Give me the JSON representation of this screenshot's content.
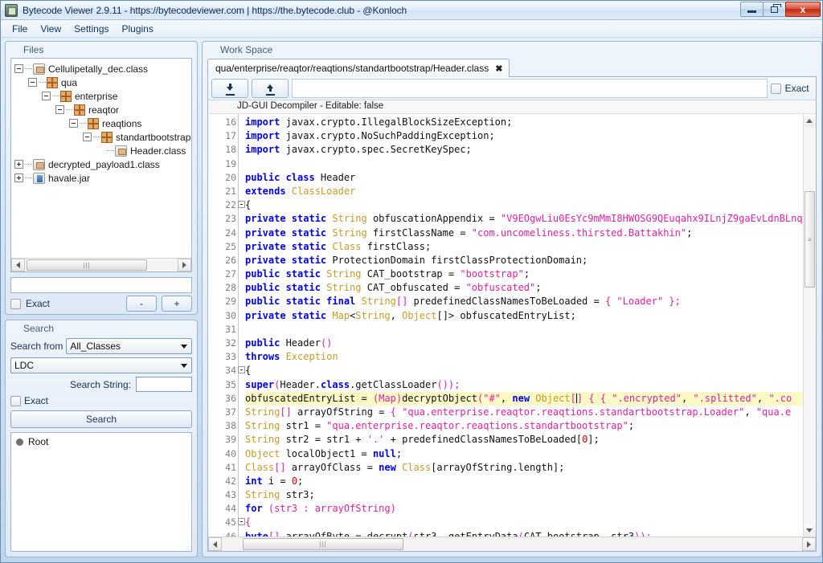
{
  "window": {
    "title": "Bytecode Viewer 2.9.11 - https://bytecodeviewer.com | https://the.bytecode.club - @Konloch",
    "app_icon": "app-icon",
    "minimize_label": "",
    "restore_label": "",
    "close_label": "x"
  },
  "menubar": {
    "items": [
      {
        "label": "File"
      },
      {
        "label": "View"
      },
      {
        "label": "Settings"
      },
      {
        "label": "Plugins"
      }
    ]
  },
  "files_panel": {
    "title": "Files",
    "tree": [
      {
        "label": "Cellulipetally_dec.class",
        "icon": "class-file-icon",
        "indent": 0,
        "toggle": "minus"
      },
      {
        "label": "qua",
        "icon": "package-icon",
        "indent": 1,
        "toggle": "minus"
      },
      {
        "label": "enterprise",
        "icon": "package-icon",
        "indent": 2,
        "toggle": "minus"
      },
      {
        "label": "reaqtor",
        "icon": "package-icon",
        "indent": 3,
        "toggle": "minus"
      },
      {
        "label": "reaqtions",
        "icon": "package-icon",
        "indent": 4,
        "toggle": "minus"
      },
      {
        "label": "standartbootstrap",
        "icon": "package-icon",
        "indent": 5,
        "toggle": "minus"
      },
      {
        "label": "Header.class",
        "icon": "class-file-icon",
        "indent": 6,
        "toggle": "none"
      },
      {
        "label": "decrypted_payload1.class",
        "icon": "class-file-icon",
        "indent": 0,
        "toggle": "plus"
      },
      {
        "label": "havale.jar",
        "icon": "jar-file-icon",
        "indent": 0,
        "toggle": "plus"
      }
    ],
    "field_value": "",
    "exact_label": "Exact",
    "exact_checked": false,
    "minus_label": "-",
    "plus_label": "+"
  },
  "search_panel": {
    "title": "Search",
    "search_from_label": "Search from",
    "scope_value": "All_Classes",
    "type_value": "LDC",
    "search_string_label": "Search String:",
    "search_string_value": "",
    "exact_label": "Exact",
    "exact_checked": false,
    "search_button_label": "Search",
    "results_root_label": "Root"
  },
  "workspace": {
    "title": "Work Space",
    "tab_label": "qua/enterprise/reaqtor/reaqtions/standartbootstrap/Header.class",
    "tab_close": "✖",
    "toolbar": {
      "download_icon": "download-arrow-icon",
      "upload_icon": "upload-arrow-icon",
      "search_value": "",
      "exact_label": "Exact",
      "exact_checked": false
    },
    "status_text": "JD-GUI Decompiler - Editable: false",
    "highlighted_line": 36,
    "first_visible_line": 16,
    "code": [
      {
        "n": 16,
        "fold": false,
        "tokens": [
          {
            "t": "import ",
            "c": "kw"
          },
          {
            "t": "javax.crypto.IllegalBlockSizeException;",
            "c": "pl"
          }
        ]
      },
      {
        "n": 17,
        "fold": false,
        "tokens": [
          {
            "t": "import ",
            "c": "kw"
          },
          {
            "t": "javax.crypto.NoSuchPaddingException;",
            "c": "pl"
          }
        ]
      },
      {
        "n": 18,
        "fold": false,
        "tokens": [
          {
            "t": "import ",
            "c": "kw"
          },
          {
            "t": "javax.crypto.spec.SecretKeySpec;",
            "c": "pl"
          }
        ]
      },
      {
        "n": 19,
        "fold": false,
        "tokens": []
      },
      {
        "n": 20,
        "fold": false,
        "tokens": [
          {
            "t": "public class ",
            "c": "kw"
          },
          {
            "t": "Header",
            "c": "pl"
          }
        ]
      },
      {
        "n": 21,
        "fold": false,
        "tokens": [
          {
            "t": "  ",
            "c": "pl"
          },
          {
            "t": "extends ",
            "c": "kw"
          },
          {
            "t": "ClassLoader",
            "c": "typ"
          }
        ]
      },
      {
        "n": 22,
        "fold": true,
        "tokens": [
          {
            "t": "{",
            "c": "pl"
          }
        ]
      },
      {
        "n": 23,
        "fold": false,
        "tokens": [
          {
            "t": "  ",
            "c": "pl"
          },
          {
            "t": "private static ",
            "c": "kw"
          },
          {
            "t": "String",
            "c": "typ"
          },
          {
            "t": " obfuscationAppendix = ",
            "c": "pl"
          },
          {
            "t": "\"V9EOgwLiu0EsYc9mMmI8HWOSG9QEuqahx9ILnjZ9gaEvLdnBLnq",
            "c": "str"
          }
        ]
      },
      {
        "n": 24,
        "fold": false,
        "tokens": [
          {
            "t": "  ",
            "c": "pl"
          },
          {
            "t": "private static ",
            "c": "kw"
          },
          {
            "t": "String",
            "c": "typ"
          },
          {
            "t": " firstClassName = ",
            "c": "pl"
          },
          {
            "t": "\"com.uncomeliness.thirsted.Battakhin\"",
            "c": "str"
          },
          {
            "t": ";",
            "c": "pl"
          }
        ]
      },
      {
        "n": 25,
        "fold": false,
        "tokens": [
          {
            "t": "  ",
            "c": "pl"
          },
          {
            "t": "private static ",
            "c": "kw"
          },
          {
            "t": "Class",
            "c": "typ"
          },
          {
            "t": " firstClass;",
            "c": "pl"
          }
        ]
      },
      {
        "n": 26,
        "fold": false,
        "tokens": [
          {
            "t": "  ",
            "c": "pl"
          },
          {
            "t": "private static ",
            "c": "kw"
          },
          {
            "t": "ProtectionDomain firstClassProtectionDomain;",
            "c": "pl"
          }
        ]
      },
      {
        "n": 27,
        "fold": false,
        "tokens": [
          {
            "t": "  ",
            "c": "pl"
          },
          {
            "t": "public static ",
            "c": "kw"
          },
          {
            "t": "String",
            "c": "typ"
          },
          {
            "t": " CAT_bootstrap = ",
            "c": "pl"
          },
          {
            "t": "\"bootstrap\"",
            "c": "str"
          },
          {
            "t": ";",
            "c": "pl"
          }
        ]
      },
      {
        "n": 28,
        "fold": false,
        "tokens": [
          {
            "t": "  ",
            "c": "pl"
          },
          {
            "t": "public static ",
            "c": "kw"
          },
          {
            "t": "String",
            "c": "typ"
          },
          {
            "t": " CAT_obfuscated = ",
            "c": "pl"
          },
          {
            "t": "\"obfuscated\"",
            "c": "str"
          },
          {
            "t": ";",
            "c": "pl"
          }
        ]
      },
      {
        "n": 29,
        "fold": false,
        "tokens": [
          {
            "t": "  ",
            "c": "pl"
          },
          {
            "t": "public static final ",
            "c": "kw"
          },
          {
            "t": "String",
            "c": "typ"
          },
          {
            "t": "[]",
            "c": "str"
          },
          {
            "t": " predefinedClassNamesToBeLoaded = ",
            "c": "pl"
          },
          {
            "t": "{ ",
            "c": "str"
          },
          {
            "t": "\"Loader\"",
            "c": "str"
          },
          {
            "t": " };",
            "c": "str"
          }
        ]
      },
      {
        "n": 30,
        "fold": false,
        "tokens": [
          {
            "t": "  ",
            "c": "pl"
          },
          {
            "t": "private static ",
            "c": "kw"
          },
          {
            "t": "Map",
            "c": "typ"
          },
          {
            "t": "<",
            "c": "pl"
          },
          {
            "t": "String",
            "c": "typ"
          },
          {
            "t": ", ",
            "c": "pl"
          },
          {
            "t": "Object",
            "c": "typ"
          },
          {
            "t": "[]> obfuscatedEntryList;",
            "c": "pl"
          }
        ]
      },
      {
        "n": 31,
        "fold": false,
        "tokens": []
      },
      {
        "n": 32,
        "fold": false,
        "tokens": [
          {
            "t": "  ",
            "c": "pl"
          },
          {
            "t": "public ",
            "c": "kw"
          },
          {
            "t": "Header",
            "c": "pl"
          },
          {
            "t": "()",
            "c": "str"
          }
        ]
      },
      {
        "n": 33,
        "fold": false,
        "tokens": [
          {
            "t": "    ",
            "c": "pl"
          },
          {
            "t": "throws ",
            "c": "kw"
          },
          {
            "t": "Exception",
            "c": "typ"
          }
        ]
      },
      {
        "n": 34,
        "fold": true,
        "tokens": [
          {
            "t": "  {",
            "c": "pl"
          }
        ]
      },
      {
        "n": 35,
        "fold": false,
        "tokens": [
          {
            "t": "    ",
            "c": "pl"
          },
          {
            "t": "super",
            "c": "kw"
          },
          {
            "t": "(",
            "c": "str"
          },
          {
            "t": "Header.",
            "c": "pl"
          },
          {
            "t": "class",
            "c": "kw"
          },
          {
            "t": ".getClassLoader",
            "c": "pl"
          },
          {
            "t": "());",
            "c": "str"
          }
        ]
      },
      {
        "n": 36,
        "fold": false,
        "hl": true,
        "tokens": [
          {
            "t": "    obfuscatedEntryList = ",
            "c": "pl"
          },
          {
            "t": "(Map)",
            "c": "str"
          },
          {
            "t": "decryptObject",
            "c": "pl"
          },
          {
            "t": "(",
            "c": "str"
          },
          {
            "t": "\"#\"",
            "c": "str"
          },
          {
            "t": ", ",
            "c": "pl"
          },
          {
            "t": "new ",
            "c": "kw"
          },
          {
            "t": "Object",
            "c": "typ"
          },
          {
            "t": "[",
            "c": "str"
          },
          {
            "t": "CURSOR",
            "c": "cursor"
          },
          {
            "t": "]",
            "c": "str"
          },
          {
            "t": " { { ",
            "c": "str"
          },
          {
            "t": "\".encrypted\"",
            "c": "str"
          },
          {
            "t": ", ",
            "c": "pl"
          },
          {
            "t": "\".splitted\"",
            "c": "str"
          },
          {
            "t": ", ",
            "c": "pl"
          },
          {
            "t": "\".co",
            "c": "str"
          }
        ]
      },
      {
        "n": 37,
        "fold": false,
        "tokens": [
          {
            "t": "    ",
            "c": "pl"
          },
          {
            "t": "String",
            "c": "typ"
          },
          {
            "t": "[]",
            "c": "str"
          },
          {
            "t": " arrayOfString = ",
            "c": "pl"
          },
          {
            "t": "{ ",
            "c": "str"
          },
          {
            "t": "\"qua.enterprise.reaqtor.reaqtions.standartbootstrap.Loader\"",
            "c": "str"
          },
          {
            "t": ", ",
            "c": "pl"
          },
          {
            "t": "\"qua.e",
            "c": "str"
          }
        ]
      },
      {
        "n": 38,
        "fold": false,
        "tokens": [
          {
            "t": "    ",
            "c": "pl"
          },
          {
            "t": "String",
            "c": "typ"
          },
          {
            "t": " str1 = ",
            "c": "pl"
          },
          {
            "t": "\"qua.enterprise.reaqtor.reaqtions.standartbootstrap\"",
            "c": "str"
          },
          {
            "t": ";",
            "c": "pl"
          }
        ]
      },
      {
        "n": 39,
        "fold": false,
        "tokens": [
          {
            "t": "    ",
            "c": "pl"
          },
          {
            "t": "String",
            "c": "typ"
          },
          {
            "t": " str2 = str1 + ",
            "c": "pl"
          },
          {
            "t": "'.'",
            "c": "str"
          },
          {
            "t": " + predefinedClassNamesToBeLoaded[",
            "c": "pl"
          },
          {
            "t": "0",
            "c": "num"
          },
          {
            "t": "];",
            "c": "pl"
          }
        ]
      },
      {
        "n": 40,
        "fold": false,
        "tokens": [
          {
            "t": "    ",
            "c": "pl"
          },
          {
            "t": "Object",
            "c": "typ"
          },
          {
            "t": " localObject1 = ",
            "c": "pl"
          },
          {
            "t": "null",
            "c": "kw"
          },
          {
            "t": ";",
            "c": "pl"
          }
        ]
      },
      {
        "n": 41,
        "fold": false,
        "tokens": [
          {
            "t": "    ",
            "c": "pl"
          },
          {
            "t": "Class",
            "c": "typ"
          },
          {
            "t": "[]",
            "c": "str"
          },
          {
            "t": " arrayOfClass = ",
            "c": "pl"
          },
          {
            "t": "new ",
            "c": "kw"
          },
          {
            "t": "Class",
            "c": "typ"
          },
          {
            "t": "[arrayOfString.length];",
            "c": "pl"
          }
        ]
      },
      {
        "n": 42,
        "fold": false,
        "tokens": [
          {
            "t": "    ",
            "c": "pl"
          },
          {
            "t": "int",
            "c": "kw"
          },
          {
            "t": " i = ",
            "c": "pl"
          },
          {
            "t": "0",
            "c": "num"
          },
          {
            "t": ";",
            "c": "pl"
          }
        ]
      },
      {
        "n": 43,
        "fold": false,
        "tokens": [
          {
            "t": "    ",
            "c": "pl"
          },
          {
            "t": "String",
            "c": "typ"
          },
          {
            "t": " str3;",
            "c": "pl"
          }
        ]
      },
      {
        "n": 44,
        "fold": false,
        "tokens": [
          {
            "t": "    ",
            "c": "pl"
          },
          {
            "t": "for ",
            "c": "kw"
          },
          {
            "t": "(str3 : arrayOfString)",
            "c": "str"
          }
        ]
      },
      {
        "n": 45,
        "fold": true,
        "tokens": [
          {
            "t": "    {",
            "c": "str"
          }
        ]
      },
      {
        "n": 46,
        "fold": false,
        "tokens": [
          {
            "t": "      ",
            "c": "pl"
          },
          {
            "t": "byte",
            "c": "kw"
          },
          {
            "t": "[]",
            "c": "str"
          },
          {
            "t": " arrayOfByte = decrypt",
            "c": "pl"
          },
          {
            "t": "(",
            "c": "str"
          },
          {
            "t": "str3, getEntryData",
            "c": "pl"
          },
          {
            "t": "(",
            "c": "str"
          },
          {
            "t": "CAT_bootstrap, str3",
            "c": "pl"
          },
          {
            "t": "));",
            "c": "str"
          }
        ]
      }
    ]
  },
  "colors": {
    "keyword": "#0000e6",
    "type": "#c89b2a",
    "string": "#e020a0",
    "number": "#d00000",
    "highlight": "#fcf9c4",
    "package_icon": "#e6a86b",
    "close_button": "#bd2a16"
  }
}
